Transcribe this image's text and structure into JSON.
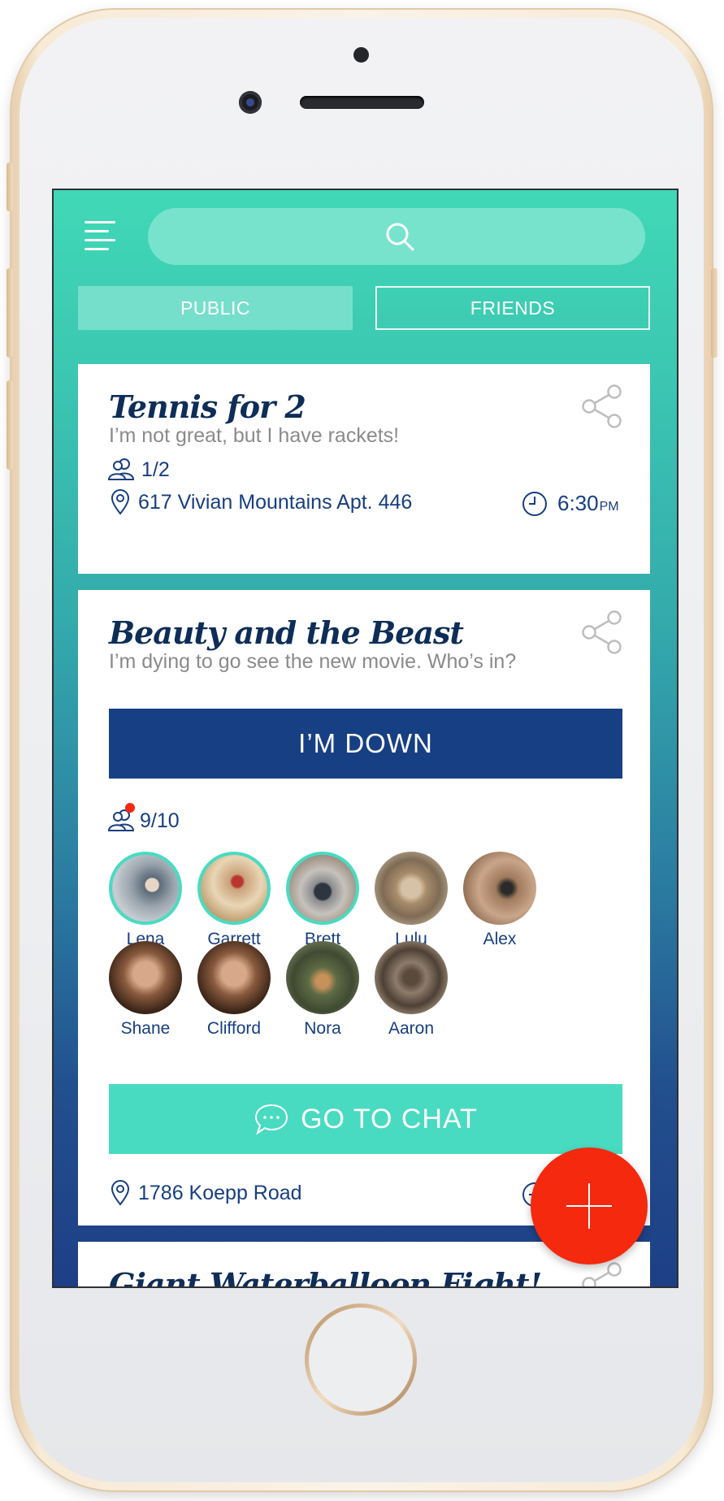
{
  "header": {
    "tabs": [
      {
        "label": "PUBLIC",
        "active": true
      },
      {
        "label": "FRIENDS",
        "active": false
      }
    ]
  },
  "events": [
    {
      "title": "Tennis for 2",
      "description": "I’m not great, but I have rackets!",
      "attendees": "1/2",
      "address": "617 Vivian Mountains Apt. 446",
      "time": "6:30",
      "time_suffix": "PM"
    },
    {
      "title": "Beauty and the Beast",
      "description": "I’m dying to go see the new movie. Who’s in?",
      "join_label": "I’M DOWN",
      "attendees": "9/10",
      "people": [
        {
          "name": "Lena",
          "selected": true
        },
        {
          "name": "Garrett",
          "selected": true
        },
        {
          "name": "Brett",
          "selected": true
        },
        {
          "name": "Lulu",
          "selected": false
        },
        {
          "name": "Alex",
          "selected": false
        },
        {
          "name": "Shane",
          "selected": false
        },
        {
          "name": "Clifford",
          "selected": false
        },
        {
          "name": "Nora",
          "selected": false
        },
        {
          "name": "Aaron",
          "selected": false
        }
      ],
      "chat_label": "GO TO CHAT",
      "address": "1786 Koepp Road"
    },
    {
      "title": "Giant Waterballoon Fight!"
    }
  ],
  "colors": {
    "accent_teal": "#49dbc1",
    "navy": "#173f83",
    "fab_red": "#f4290e"
  },
  "icons": [
    "menu-icon",
    "search-icon",
    "share-icon",
    "people-icon",
    "location-pin-icon",
    "clock-icon",
    "chat-bubble-icon",
    "plus-icon"
  ]
}
